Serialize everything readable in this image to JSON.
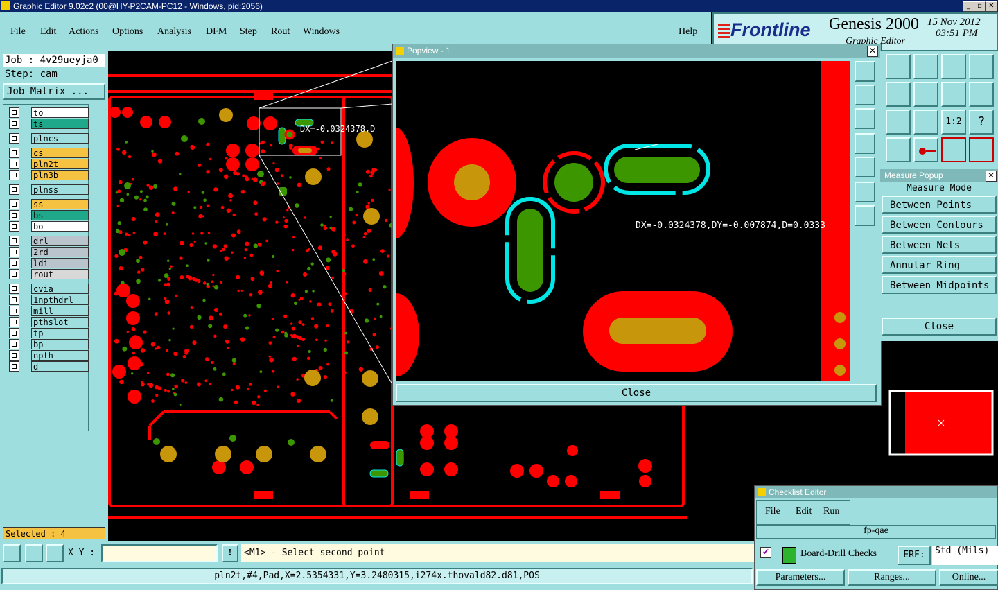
{
  "window": {
    "title": "Graphic Editor 9.02c2 (00@HY-P2CAM-PC12 - Windows, pid:2056)",
    "btn_min": "_",
    "btn_max": "▫",
    "btn_close": "✕"
  },
  "menu": {
    "file": "File",
    "edit": "Edit",
    "actions": "Actions",
    "options": "Options",
    "analysis": "Analysis",
    "dfm": "DFM",
    "step": "Step",
    "rout": "Rout",
    "windows": "Windows",
    "help": "Help"
  },
  "logo": {
    "brand": "Frontline",
    "product": "Genesis 2000",
    "subtitle": "Graphic Editor",
    "date": "15 Nov 2012",
    "time": "03:51 PM"
  },
  "job": {
    "job_line": "Job : 4v29ueyja0",
    "step_line": "Step: cam",
    "matrix_button": "Job Matrix ..."
  },
  "layers": [
    {
      "name": "to",
      "color": "#ffffff"
    },
    {
      "name": "ts",
      "color": "#1fa98a"
    },
    {
      "name": "plncs",
      "color": "#9fdede"
    },
    {
      "name": "cs",
      "color": "#f5c242"
    },
    {
      "name": "pln2t",
      "color": "#f5c242"
    },
    {
      "name": "pln3b",
      "color": "#f5c242"
    },
    {
      "name": "plnss",
      "color": "#9fdede"
    },
    {
      "name": "ss",
      "color": "#f5c242"
    },
    {
      "name": "bs",
      "color": "#1fa98a"
    },
    {
      "name": "bo",
      "color": "#ffffff"
    },
    {
      "name": "drl",
      "color": "#b9c4cc"
    },
    {
      "name": "2rd",
      "color": "#b9c4cc"
    },
    {
      "name": "ldi",
      "color": "#b9c4cc"
    },
    {
      "name": "rout",
      "color": "#d8d8d8"
    },
    {
      "name": "cvia",
      "color": "#9fdede"
    },
    {
      "name": "1npthdrl",
      "color": "#9fdede"
    },
    {
      "name": "mill",
      "color": "#9fdede"
    },
    {
      "name": "pthslot",
      "color": "#9fdede"
    },
    {
      "name": "tp",
      "color": "#9fdede"
    },
    {
      "name": "bp",
      "color": "#9fdede"
    },
    {
      "name": "npth",
      "color": "#9fdede"
    },
    {
      "name": "d",
      "color": "#9fdede"
    }
  ],
  "selected": "Selected : 4",
  "xy": {
    "label": "X Y :",
    "value": "",
    "bang": "!"
  },
  "prompt": "<M1> - Select second point",
  "status": "pln2t,#4,Pad,X=2.5354331,Y=3.2480315,i274x.thovald82.d81,POS",
  "canvas_measure": "DX=-0.0324378,D",
  "popview": {
    "title": "Popview - 1",
    "measure": "DX=-0.0324378,DY=-0.007874,D=0.0333",
    "close": "Close"
  },
  "measure_popup": {
    "title": "Measure Popup",
    "mode_label": "Measure Mode",
    "items": [
      "Between Points",
      "Between Contours",
      "Between Nets",
      "Annular Ring",
      "Between Midpoints"
    ],
    "close": "Close"
  },
  "checklist": {
    "title": "Checklist Editor",
    "menu": {
      "file": "File",
      "edit": "Edit",
      "run": "Run"
    },
    "name": "fp-qae",
    "check_name": "Board-Drill Checks",
    "erf_label": "ERF:",
    "erf_value": "Std (Mils)",
    "buttons": {
      "parameters": "Parameters...",
      "ranges": "Ranges...",
      "online": "Online..."
    }
  },
  "tool_labels": {
    "one_to_two": "1:2",
    "help": "?"
  },
  "colors": {
    "panel": "#9fdede",
    "copper": "#ff0000",
    "drill": "#c8960a",
    "green": "#3c9600",
    "cyan": "#00e6e6"
  }
}
